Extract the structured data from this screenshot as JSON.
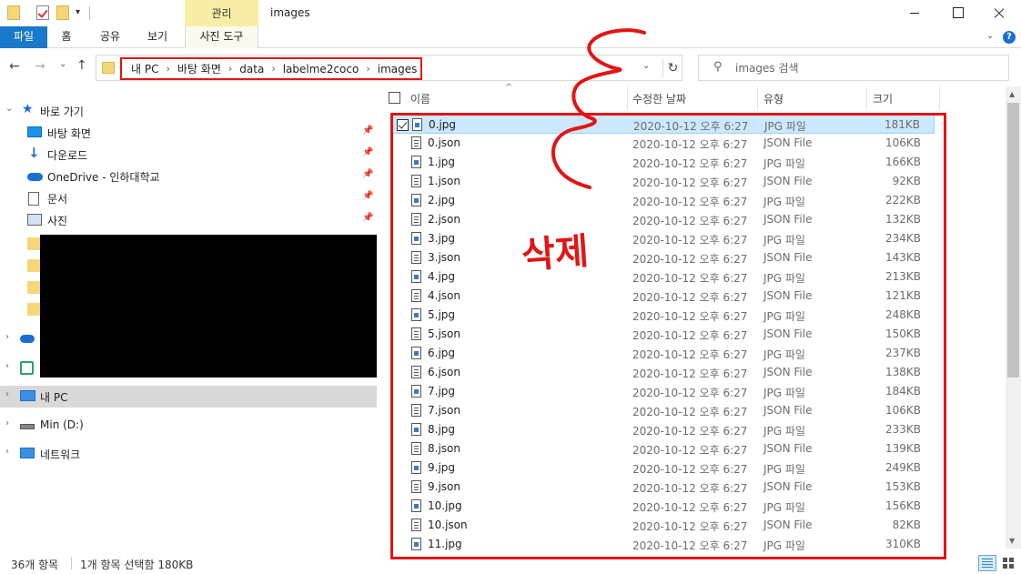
{
  "window": {
    "title": "images",
    "context_tab": "관리"
  },
  "ribbon": {
    "tabs": [
      "파일",
      "홈",
      "공유",
      "보기",
      "사진 도구"
    ]
  },
  "address": {
    "crumbs": [
      "내 PC",
      "바탕 화면",
      "data",
      "labelme2coco",
      "images"
    ]
  },
  "search": {
    "placeholder": "images 검색"
  },
  "nav": {
    "quick_access": "바로 가기",
    "items": [
      "바탕 화면",
      "다운로드",
      "OneDrive - 인하대학교",
      "문서",
      "사진"
    ],
    "this_pc": "내 PC",
    "drive": "Min (D:)",
    "network": "네트워크"
  },
  "columns": {
    "name": "이름",
    "date": "수정한 날짜",
    "type": "유형",
    "size": "크기"
  },
  "files": [
    {
      "name": "0.jpg",
      "date": "2020-10-12 오후 6:27",
      "type": "JPG 파일",
      "size": "181KB"
    },
    {
      "name": "0.json",
      "date": "2020-10-12 오후 6:27",
      "type": "JSON File",
      "size": "106KB"
    },
    {
      "name": "1.jpg",
      "date": "2020-10-12 오후 6:27",
      "type": "JPG 파일",
      "size": "166KB"
    },
    {
      "name": "1.json",
      "date": "2020-10-12 오후 6:27",
      "type": "JSON File",
      "size": "92KB"
    },
    {
      "name": "2.jpg",
      "date": "2020-10-12 오후 6:27",
      "type": "JPG 파일",
      "size": "222KB"
    },
    {
      "name": "2.json",
      "date": "2020-10-12 오후 6:27",
      "type": "JSON File",
      "size": "132KB"
    },
    {
      "name": "3.jpg",
      "date": "2020-10-12 오후 6:27",
      "type": "JPG 파일",
      "size": "234KB"
    },
    {
      "name": "3.json",
      "date": "2020-10-12 오후 6:27",
      "type": "JSON File",
      "size": "143KB"
    },
    {
      "name": "4.jpg",
      "date": "2020-10-12 오후 6:27",
      "type": "JPG 파일",
      "size": "213KB"
    },
    {
      "name": "4.json",
      "date": "2020-10-12 오후 6:27",
      "type": "JSON File",
      "size": "121KB"
    },
    {
      "name": "5.jpg",
      "date": "2020-10-12 오후 6:27",
      "type": "JPG 파일",
      "size": "248KB"
    },
    {
      "name": "5.json",
      "date": "2020-10-12 오후 6:27",
      "type": "JSON File",
      "size": "150KB"
    },
    {
      "name": "6.jpg",
      "date": "2020-10-12 오후 6:27",
      "type": "JPG 파일",
      "size": "237KB"
    },
    {
      "name": "6.json",
      "date": "2020-10-12 오후 6:27",
      "type": "JSON File",
      "size": "138KB"
    },
    {
      "name": "7.jpg",
      "date": "2020-10-12 오후 6:27",
      "type": "JPG 파일",
      "size": "184KB"
    },
    {
      "name": "7.json",
      "date": "2020-10-12 오후 6:27",
      "type": "JSON File",
      "size": "106KB"
    },
    {
      "name": "8.jpg",
      "date": "2020-10-12 오후 6:27",
      "type": "JPG 파일",
      "size": "233KB"
    },
    {
      "name": "8.json",
      "date": "2020-10-12 오후 6:27",
      "type": "JSON File",
      "size": "139KB"
    },
    {
      "name": "9.jpg",
      "date": "2020-10-12 오후 6:27",
      "type": "JPG 파일",
      "size": "249KB"
    },
    {
      "name": "9.json",
      "date": "2020-10-12 오후 6:27",
      "type": "JSON File",
      "size": "153KB"
    },
    {
      "name": "10.jpg",
      "date": "2020-10-12 오후 6:27",
      "type": "JPG 파일",
      "size": "156KB"
    },
    {
      "name": "10.json",
      "date": "2020-10-12 오후 6:27",
      "type": "JSON File",
      "size": "82KB"
    },
    {
      "name": "11.jpg",
      "date": "2020-10-12 오후 6:27",
      "type": "JPG 파일",
      "size": "310KB"
    }
  ],
  "status": {
    "count": "36개 항목",
    "selection": "1개 항목 선택함 180KB"
  },
  "annotation": {
    "text": "삭제",
    "color": "#e31414"
  },
  "colors": {
    "accent": "#1979ca",
    "selection": "#cce8ff",
    "highlight_box": "#e31414",
    "context_tab": "#f7eda4"
  }
}
